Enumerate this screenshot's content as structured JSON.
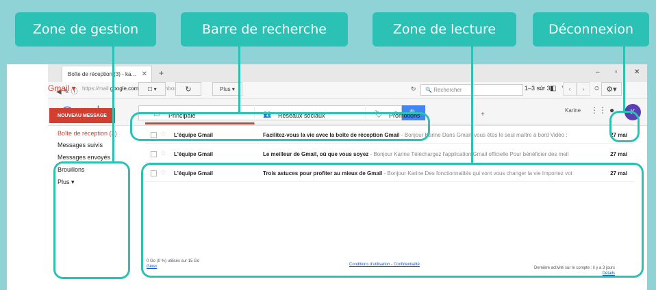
{
  "callouts": {
    "management": "Zone de gestion",
    "search": "Barre de recherche",
    "reading": "Zone de lecture",
    "logout": "Déconnexion"
  },
  "browser": {
    "tab_title": "Boîte de réception (3) - ka...",
    "new_tab": "+",
    "url_prefix": "https://mail.",
    "url_domain": "google.com",
    "url_path": "/mail/u/2/#inbox",
    "search_placeholder": "Rechercher",
    "win_min": "–",
    "win_max": "▫",
    "win_close": "✕"
  },
  "google": {
    "logo": "Google",
    "user_name": "Karine",
    "avatar_letter": "K"
  },
  "gmail": {
    "label": "Gmail ▾",
    "more_button": "Plus ▾",
    "pager": "1–3 sur 3",
    "compose": "NOUVEAU MESSAGE",
    "nav": [
      {
        "label": "Boîte de réception (3)"
      },
      {
        "label": "Messages suivis"
      },
      {
        "label": "Messages envoyés"
      },
      {
        "label": "Brouillons"
      },
      {
        "label": "Plus ▾"
      }
    ],
    "tabs": [
      {
        "label": "Principale"
      },
      {
        "label": "Réseaux sociaux"
      },
      {
        "label": "Promotions"
      }
    ],
    "messages": [
      {
        "from": "L'équipe Gmail",
        "subject": "Facilitez-vous la vie avec la boîte de réception Gmail",
        "snippet": " - Bonjour Karine Dans Gmail, vous êtes le seul maître à bord Vidéo :",
        "date": "27 mai"
      },
      {
        "from": "L'équipe Gmail",
        "subject": "Le meilleur de Gmail, où que vous soyez",
        "snippet": " - Bonjour Karine Téléchargez l'application Gmail officielle Pour bénéficier des meil",
        "date": "27 mai"
      },
      {
        "from": "L'équipe Gmail",
        "subject": "Trois astuces pour profiter au mieux de Gmail",
        "snippet": " - Bonjour Karine Des fonctionnalités qui vont vous changer la vie Importez vot",
        "date": "27 mai"
      }
    ],
    "footer": {
      "storage": "0 Go (0 %) utilisés sur 15 Go",
      "manage": "Gérer",
      "terms": "Conditions d'utilisation - Confidentialité",
      "activity": "Dernière activité sur le compte : il y a 3 jours",
      "details": "Détails"
    }
  },
  "colors": {
    "accent": "#2bc1b5",
    "gmail_red": "#d23f31",
    "google_blue": "#4285f4",
    "avatar": "#5c3fb5"
  }
}
